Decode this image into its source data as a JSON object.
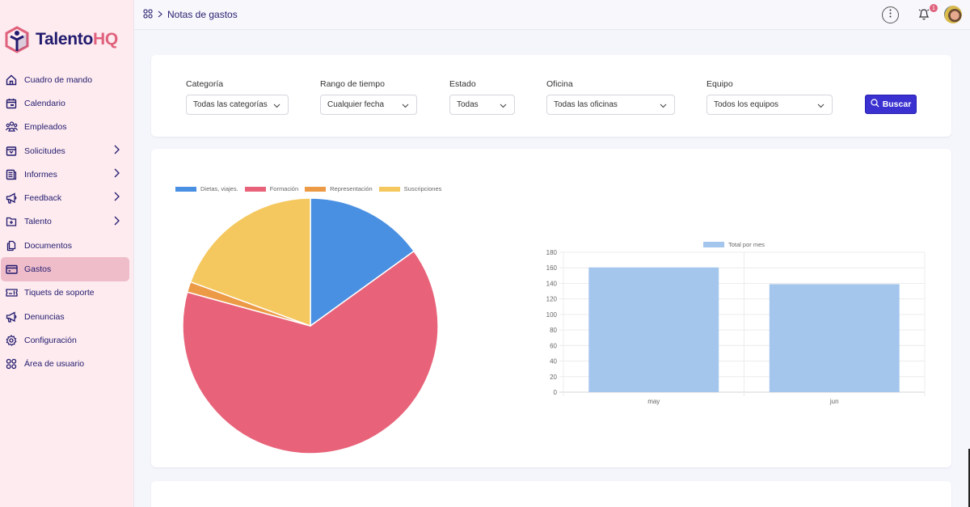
{
  "app": {
    "name_part1": "Talento",
    "name_part2": "HQ"
  },
  "breadcrumb": {
    "current": "Notas de gastos"
  },
  "topbar": {
    "notification_count": "1"
  },
  "sidebar": {
    "items": [
      {
        "label": "Cuadro de mando",
        "icon": "home-icon",
        "has_children": false
      },
      {
        "label": "Calendario",
        "icon": "calendar-icon",
        "has_children": false
      },
      {
        "label": "Empleados",
        "icon": "users-icon",
        "has_children": false
      },
      {
        "label": "Solicitudes",
        "icon": "inbox-icon",
        "has_children": true
      },
      {
        "label": "Informes",
        "icon": "report-icon",
        "has_children": true
      },
      {
        "label": "Feedback",
        "icon": "megaphone-icon",
        "has_children": true
      },
      {
        "label": "Talento",
        "icon": "folder-plus-icon",
        "has_children": true
      },
      {
        "label": "Documentos",
        "icon": "documents-icon",
        "has_children": false
      },
      {
        "label": "Gastos",
        "icon": "credit-card-icon",
        "has_children": false,
        "active": true
      },
      {
        "label": "Tiquets de soporte",
        "icon": "ticket-icon",
        "has_children": false
      },
      {
        "label": "Denuncias",
        "icon": "megaphone-icon",
        "has_children": false
      },
      {
        "label": "Configuración",
        "icon": "gear-icon",
        "has_children": false
      },
      {
        "label": "Área de usuario",
        "icon": "grid-icon",
        "has_children": false
      }
    ]
  },
  "filters": {
    "categoria": {
      "label": "Categoría",
      "value": "Todas las categorías"
    },
    "rango": {
      "label": "Rango de tiempo",
      "value": "Cualquier fecha"
    },
    "estado": {
      "label": "Estado",
      "value": "Todas"
    },
    "oficina": {
      "label": "Oficina",
      "value": "Todas las oficinas"
    },
    "equipo": {
      "label": "Equipo",
      "value": "Todos los equipos"
    },
    "search_label": "Buscar"
  },
  "colors": {
    "accent": "#3a31d0",
    "brand_pink": "#e0617c",
    "active_nav": "#efbdca"
  },
  "chart_data": [
    {
      "type": "pie",
      "title": "",
      "legend_position": "top-left",
      "categories": [
        "Dietas, viajes.",
        "Formación",
        "Representación",
        "Suscripciones"
      ],
      "values": [
        45,
        192,
        4,
        58
      ],
      "colors": [
        "#4a90e2",
        "#e8637a",
        "#ec9a45",
        "#f4c85e"
      ]
    },
    {
      "type": "bar",
      "title": "",
      "legend_position": "top",
      "series": [
        {
          "name": "Total por mes",
          "values": [
            160.5,
            139
          ],
          "color": "#a4c6ec"
        }
      ],
      "categories": [
        "may",
        "jun"
      ],
      "yticks": [
        0,
        20,
        40,
        60,
        80,
        100,
        120,
        140,
        160,
        180
      ],
      "ylim": [
        0,
        180
      ],
      "xlabel": "",
      "ylabel": "",
      "grid": true
    }
  ]
}
